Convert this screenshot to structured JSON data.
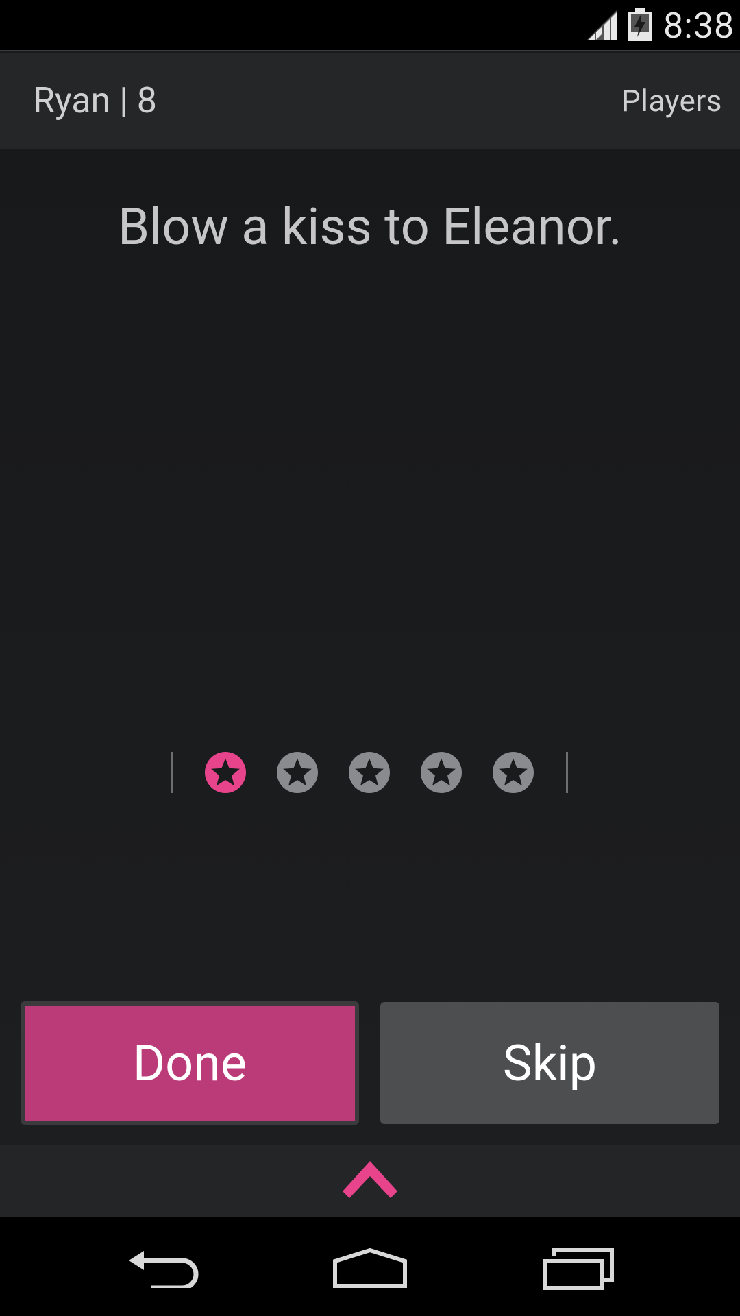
{
  "status_bar": {
    "time": "8:38",
    "icons": [
      "cell-signal-icon",
      "battery-charging-icon"
    ]
  },
  "action_bar": {
    "title": "Ryan | 8",
    "players_label": "Players"
  },
  "content": {
    "prompt": "Blow a kiss to Eleanor."
  },
  "rating": {
    "total": 5,
    "selected": 1
  },
  "buttons": {
    "done_label": "Done",
    "skip_label": "Skip"
  },
  "colors": {
    "accent": "#e8448b",
    "done_bg": "#bb3a78",
    "skip_bg": "#4d4e50",
    "star_inactive": "#8a8b8e"
  },
  "nav_bar": {
    "icons": [
      "back-icon",
      "home-icon",
      "recents-icon"
    ]
  }
}
